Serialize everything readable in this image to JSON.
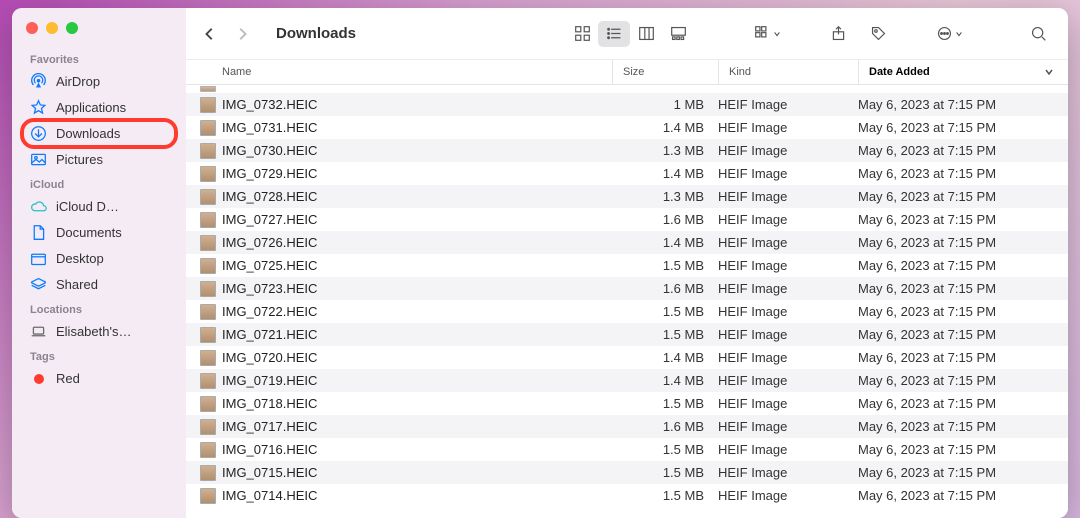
{
  "window_title": "Downloads",
  "sidebar": {
    "sections": [
      {
        "label": "Favorites",
        "items": [
          {
            "icon": "airdrop",
            "label": "AirDrop",
            "color": "blue"
          },
          {
            "icon": "apps",
            "label": "Applications",
            "color": "blue"
          },
          {
            "icon": "download",
            "label": "Downloads",
            "color": "blue",
            "highlight": true
          },
          {
            "icon": "pictures",
            "label": "Pictures",
            "color": "blue"
          }
        ]
      },
      {
        "label": "iCloud",
        "items": [
          {
            "icon": "cloud",
            "label": "iCloud D…",
            "color": "teal"
          },
          {
            "icon": "doc",
            "label": "Documents",
            "color": "blue"
          },
          {
            "icon": "desktop",
            "label": "Desktop",
            "color": "blue"
          },
          {
            "icon": "shared",
            "label": "Shared",
            "color": "blue"
          }
        ]
      },
      {
        "label": "Locations",
        "items": [
          {
            "icon": "laptop",
            "label": "Elisabeth's…",
            "color": "gray"
          }
        ]
      },
      {
        "label": "Tags",
        "items": [
          {
            "icon": "tag-dot",
            "label": "Red",
            "color": "red"
          }
        ]
      }
    ]
  },
  "columns": {
    "name": "Name",
    "size": "Size",
    "kind": "Kind",
    "date": "Date Added"
  },
  "files": [
    {
      "name": "IMG_0732.HEIC",
      "size": "1 MB",
      "kind": "HEIF Image",
      "date": "May 6, 2023 at 7:15 PM"
    },
    {
      "name": "IMG_0731.HEIC",
      "size": "1.4 MB",
      "kind": "HEIF Image",
      "date": "May 6, 2023 at 7:15 PM"
    },
    {
      "name": "IMG_0730.HEIC",
      "size": "1.3 MB",
      "kind": "HEIF Image",
      "date": "May 6, 2023 at 7:15 PM"
    },
    {
      "name": "IMG_0729.HEIC",
      "size": "1.4 MB",
      "kind": "HEIF Image",
      "date": "May 6, 2023 at 7:15 PM"
    },
    {
      "name": "IMG_0728.HEIC",
      "size": "1.3 MB",
      "kind": "HEIF Image",
      "date": "May 6, 2023 at 7:15 PM"
    },
    {
      "name": "IMG_0727.HEIC",
      "size": "1.6 MB",
      "kind": "HEIF Image",
      "date": "May 6, 2023 at 7:15 PM"
    },
    {
      "name": "IMG_0726.HEIC",
      "size": "1.4 MB",
      "kind": "HEIF Image",
      "date": "May 6, 2023 at 7:15 PM"
    },
    {
      "name": "IMG_0725.HEIC",
      "size": "1.5 MB",
      "kind": "HEIF Image",
      "date": "May 6, 2023 at 7:15 PM"
    },
    {
      "name": "IMG_0723.HEIC",
      "size": "1.6 MB",
      "kind": "HEIF Image",
      "date": "May 6, 2023 at 7:15 PM"
    },
    {
      "name": "IMG_0722.HEIC",
      "size": "1.5 MB",
      "kind": "HEIF Image",
      "date": "May 6, 2023 at 7:15 PM"
    },
    {
      "name": "IMG_0721.HEIC",
      "size": "1.5 MB",
      "kind": "HEIF Image",
      "date": "May 6, 2023 at 7:15 PM"
    },
    {
      "name": "IMG_0720.HEIC",
      "size": "1.4 MB",
      "kind": "HEIF Image",
      "date": "May 6, 2023 at 7:15 PM"
    },
    {
      "name": "IMG_0719.HEIC",
      "size": "1.4 MB",
      "kind": "HEIF Image",
      "date": "May 6, 2023 at 7:15 PM"
    },
    {
      "name": "IMG_0718.HEIC",
      "size": "1.5 MB",
      "kind": "HEIF Image",
      "date": "May 6, 2023 at 7:15 PM"
    },
    {
      "name": "IMG_0717.HEIC",
      "size": "1.6 MB",
      "kind": "HEIF Image",
      "date": "May 6, 2023 at 7:15 PM"
    },
    {
      "name": "IMG_0716.HEIC",
      "size": "1.5 MB",
      "kind": "HEIF Image",
      "date": "May 6, 2023 at 7:15 PM"
    },
    {
      "name": "IMG_0715.HEIC",
      "size": "1.5 MB",
      "kind": "HEIF Image",
      "date": "May 6, 2023 at 7:15 PM"
    },
    {
      "name": "IMG_0714.HEIC",
      "size": "1.5 MB",
      "kind": "HEIF Image",
      "date": "May 6, 2023 at 7:15 PM"
    }
  ]
}
